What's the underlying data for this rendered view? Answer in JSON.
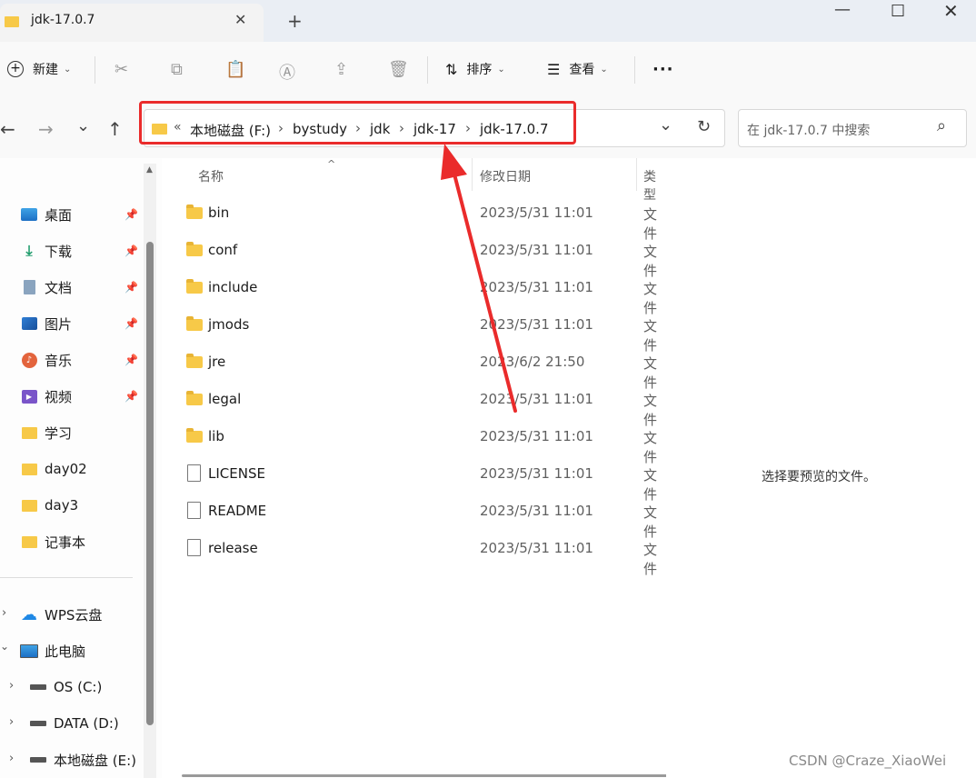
{
  "tab": {
    "title": "jdk-17.0.7",
    "close": "✕",
    "add": "+"
  },
  "window": {
    "minimize": "—",
    "maximize": "☐",
    "close": "✕"
  },
  "toolbar": {
    "new_label": "新建",
    "sort_label": "排序",
    "view_label": "查看",
    "more": "···"
  },
  "nav": {
    "back": "←",
    "forward": "→",
    "recent": "⌄",
    "up": "↑"
  },
  "address": {
    "prefix": "«",
    "crumbs": [
      "本地磁盘 (F:)",
      "bystudy",
      "jdk",
      "jdk-17",
      "jdk-17.0.7"
    ],
    "sep": "›",
    "dropdown": "⌄",
    "refresh": "↻"
  },
  "search": {
    "placeholder": "在 jdk-17.0.7 中搜索",
    "icon": "⌕"
  },
  "sidebar": {
    "quick_access": [
      {
        "label": "桌面",
        "icon": "desktop-icon",
        "pinned": true
      },
      {
        "label": "下载",
        "icon": "download-icon",
        "pinned": true
      },
      {
        "label": "文档",
        "icon": "document-icon",
        "pinned": true
      },
      {
        "label": "图片",
        "icon": "picture-icon",
        "pinned": true
      },
      {
        "label": "音乐",
        "icon": "music-icon",
        "pinned": true
      },
      {
        "label": "视频",
        "icon": "video-icon",
        "pinned": true
      },
      {
        "label": "学习",
        "icon": "folder-icon",
        "pinned": false
      },
      {
        "label": "day02",
        "icon": "folder-icon",
        "pinned": false
      },
      {
        "label": "day3",
        "icon": "folder-icon",
        "pinned": false
      },
      {
        "label": "记事本",
        "icon": "folder-icon",
        "pinned": false
      }
    ],
    "wps": "WPS云盘",
    "this_pc": "此电脑",
    "drives": [
      "OS (C:)",
      "DATA (D:)",
      "本地磁盘 (E:)"
    ],
    "pin_glyph": "📌"
  },
  "columns": {
    "name": "名称",
    "date": "修改日期",
    "type": "类型"
  },
  "files": [
    {
      "name": "bin",
      "date": "2023/5/31 11:01",
      "type": "文件",
      "kind": "folder"
    },
    {
      "name": "conf",
      "date": "2023/5/31 11:01",
      "type": "文件",
      "kind": "folder"
    },
    {
      "name": "include",
      "date": "2023/5/31 11:01",
      "type": "文件",
      "kind": "folder"
    },
    {
      "name": "jmods",
      "date": "2023/5/31 11:01",
      "type": "文件",
      "kind": "folder"
    },
    {
      "name": "jre",
      "date": "2023/6/2 21:50",
      "type": "文件",
      "kind": "folder"
    },
    {
      "name": "legal",
      "date": "2023/5/31 11:01",
      "type": "文件",
      "kind": "folder"
    },
    {
      "name": "lib",
      "date": "2023/5/31 11:01",
      "type": "文件",
      "kind": "folder"
    },
    {
      "name": "LICENSE",
      "date": "2023/5/31 11:01",
      "type": "文件",
      "kind": "file"
    },
    {
      "name": "README",
      "date": "2023/5/31 11:01",
      "type": "文件",
      "kind": "file"
    },
    {
      "name": "release",
      "date": "2023/5/31 11:01",
      "type": "文件",
      "kind": "file"
    }
  ],
  "preview": {
    "message": "选择要预览的文件。"
  },
  "watermark": "CSDN @Craze_XiaoWei",
  "colors": {
    "highlight": "#ea2b2b",
    "folder": "#f7c948"
  }
}
